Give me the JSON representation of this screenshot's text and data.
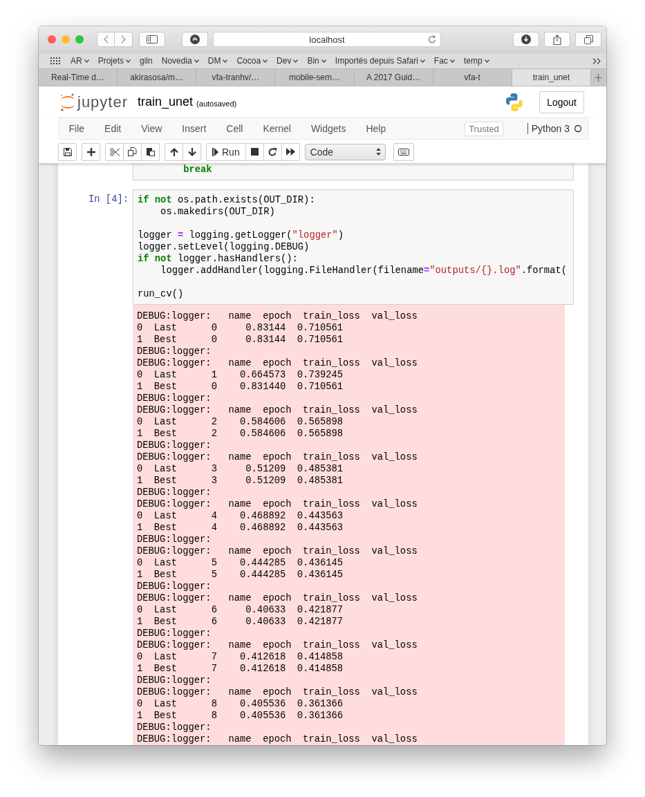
{
  "browser": {
    "address": "localhost",
    "bookmarks": [
      {
        "label": "AR",
        "has_menu": true
      },
      {
        "label": "Projets",
        "has_menu": true
      },
      {
        "label": "giln",
        "has_menu": false
      },
      {
        "label": "Novedia",
        "has_menu": true
      },
      {
        "label": "DM",
        "has_menu": true
      },
      {
        "label": "Cocoa",
        "has_menu": true
      },
      {
        "label": "Dev",
        "has_menu": true
      },
      {
        "label": "Bin",
        "has_menu": true
      },
      {
        "label": "Importés depuis Safari",
        "has_menu": true
      },
      {
        "label": "Fac",
        "has_menu": true
      },
      {
        "label": "temp",
        "has_menu": true
      }
    ],
    "tabs": [
      {
        "label": "Real-Time d…",
        "selected": false
      },
      {
        "label": "akirasosa/m…",
        "selected": false
      },
      {
        "label": "vfa-tranhv/…",
        "selected": false
      },
      {
        "label": "mobile-sem…",
        "selected": false
      },
      {
        "label": "A 2017 Guid…",
        "selected": false
      },
      {
        "label": "vfa-t",
        "selected": false
      },
      {
        "label": "train_unet",
        "selected": true
      }
    ]
  },
  "notebook": {
    "logo_text": "jupyter",
    "name": "train_unet",
    "save_status": "(autosaved)",
    "logout": "Logout",
    "menu": [
      "File",
      "Edit",
      "View",
      "Insert",
      "Cell",
      "Kernel",
      "Widgets",
      "Help"
    ],
    "trusted": "Trusted",
    "kernel": "Python 3",
    "toolbar": {
      "run": "Run",
      "cell_type": "Code"
    }
  },
  "previous_cell": {
    "lines": [
      {
        "kind": "code",
        "tokens": [
          {
            "kind": "keyword",
            "text": "        break"
          }
        ]
      }
    ]
  },
  "cell": {
    "prompt": "In [4]:",
    "lines": [
      {
        "kind": "code",
        "tokens": [
          {
            "kind": "keyword",
            "text": "if not"
          },
          {
            "kind": "plain",
            "text": " os.path.exists(OUT_DIR):"
          }
        ]
      },
      {
        "kind": "code",
        "tokens": [
          {
            "kind": "plain",
            "text": "    os.makedirs(OUT_DIR)"
          }
        ]
      },
      {
        "kind": "blank"
      },
      {
        "kind": "code",
        "tokens": [
          {
            "kind": "plain",
            "text": "logger "
          },
          {
            "kind": "operator",
            "text": "="
          },
          {
            "kind": "plain",
            "text": " logging.getLogger("
          },
          {
            "kind": "string",
            "text": "\"logger\""
          },
          {
            "kind": "plain",
            "text": ")"
          }
        ]
      },
      {
        "kind": "code",
        "tokens": [
          {
            "kind": "plain",
            "text": "logger.setLevel(logging.DEBUG)"
          }
        ]
      },
      {
        "kind": "code",
        "tokens": [
          {
            "kind": "keyword",
            "text": "if not"
          },
          {
            "kind": "plain",
            "text": " logger.hasHandlers():"
          }
        ]
      },
      {
        "kind": "code",
        "tokens": [
          {
            "kind": "plain",
            "text": "    logger.addHandler(logging.FileHandler(filename"
          },
          {
            "kind": "operator",
            "text": "="
          },
          {
            "kind": "string",
            "text": "\"outputs/{}.log\""
          },
          {
            "kind": "plain",
            "text": ".format("
          }
        ]
      },
      {
        "kind": "blank"
      },
      {
        "kind": "code",
        "tokens": [
          {
            "kind": "plain",
            "text": "run_cv()"
          }
        ]
      }
    ],
    "output": [
      "DEBUG:logger:   name  epoch  train_loss  val_loss",
      "0  Last      0     0.83144  0.710561",
      "1  Best      0     0.83144  0.710561",
      "DEBUG:logger:",
      "DEBUG:logger:   name  epoch  train_loss  val_loss",
      "0  Last      1    0.664573  0.739245",
      "1  Best      0    0.831440  0.710561",
      "DEBUG:logger:",
      "DEBUG:logger:   name  epoch  train_loss  val_loss",
      "0  Last      2    0.584606  0.565898",
      "1  Best      2    0.584606  0.565898",
      "DEBUG:logger:",
      "DEBUG:logger:   name  epoch  train_loss  val_loss",
      "0  Last      3     0.51209  0.485381",
      "1  Best      3     0.51209  0.485381",
      "DEBUG:logger:",
      "DEBUG:logger:   name  epoch  train_loss  val_loss",
      "0  Last      4    0.468892  0.443563",
      "1  Best      4    0.468892  0.443563",
      "DEBUG:logger:",
      "DEBUG:logger:   name  epoch  train_loss  val_loss",
      "0  Last      5    0.444285  0.436145",
      "1  Best      5    0.444285  0.436145",
      "DEBUG:logger:",
      "DEBUG:logger:   name  epoch  train_loss  val_loss",
      "0  Last      6     0.40633  0.421877",
      "1  Best      6     0.40633  0.421877",
      "DEBUG:logger:",
      "DEBUG:logger:   name  epoch  train_loss  val_loss",
      "0  Last      7    0.412618  0.414858",
      "1  Best      7    0.412618  0.414858",
      "DEBUG:logger:",
      "DEBUG:logger:   name  epoch  train_loss  val_loss",
      "0  Last      8    0.405536  0.361366",
      "1  Best      8    0.405536  0.361366",
      "DEBUG:logger:",
      "DEBUG:logger:   name  epoch  train_loss  val_loss"
    ]
  }
}
